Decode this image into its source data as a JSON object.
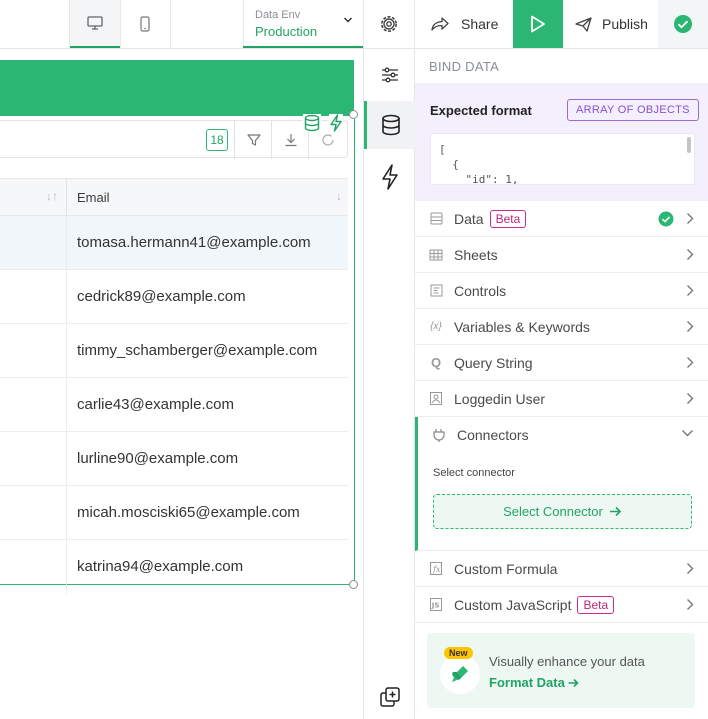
{
  "topbar": {
    "desktop_icon": "desktop-icon",
    "mobile_icon": "mobile-icon",
    "env_label": "Data Env",
    "env_value": "Production",
    "share_label": "Share",
    "publish_label": "Publish",
    "accent": "#2bb673"
  },
  "table": {
    "count": "18",
    "column_header": "Email",
    "rows": [
      "tomasa.hermann41@example.com",
      "cedrick89@example.com",
      "timmy_schamberger@example.com",
      "carlie43@example.com",
      "lurline90@example.com",
      "micah.mosciski65@example.com",
      "katrina94@example.com"
    ]
  },
  "panel": {
    "title": "BIND DATA",
    "expected_label": "Expected format",
    "format_badge": "ARRAY OF OBJECTS",
    "code_lines": [
      "[",
      "  {",
      "    \"id\": 1,"
    ],
    "items": [
      {
        "label": "Data",
        "beta": "Beta",
        "icon": "database-icon"
      },
      {
        "label": "Sheets",
        "icon": "table-icon"
      },
      {
        "label": "Controls",
        "icon": "controls-icon"
      },
      {
        "label": "Variables & Keywords",
        "icon": "variable-icon"
      },
      {
        "label": "Query String",
        "icon": "query-icon"
      },
      {
        "label": "Loggedin User",
        "icon": "user-icon"
      }
    ],
    "connectors": {
      "label": "Connectors",
      "sub_label": "Select connector",
      "button_label": "Select Connector"
    },
    "bottom_items": [
      {
        "label": "Custom Formula",
        "icon": "formula-icon"
      },
      {
        "label": "Custom JavaScript",
        "beta": "Beta",
        "icon": "js-icon"
      }
    ],
    "promo": {
      "badge": "New",
      "text": "Visually enhance your data",
      "link": "Format Data"
    }
  }
}
